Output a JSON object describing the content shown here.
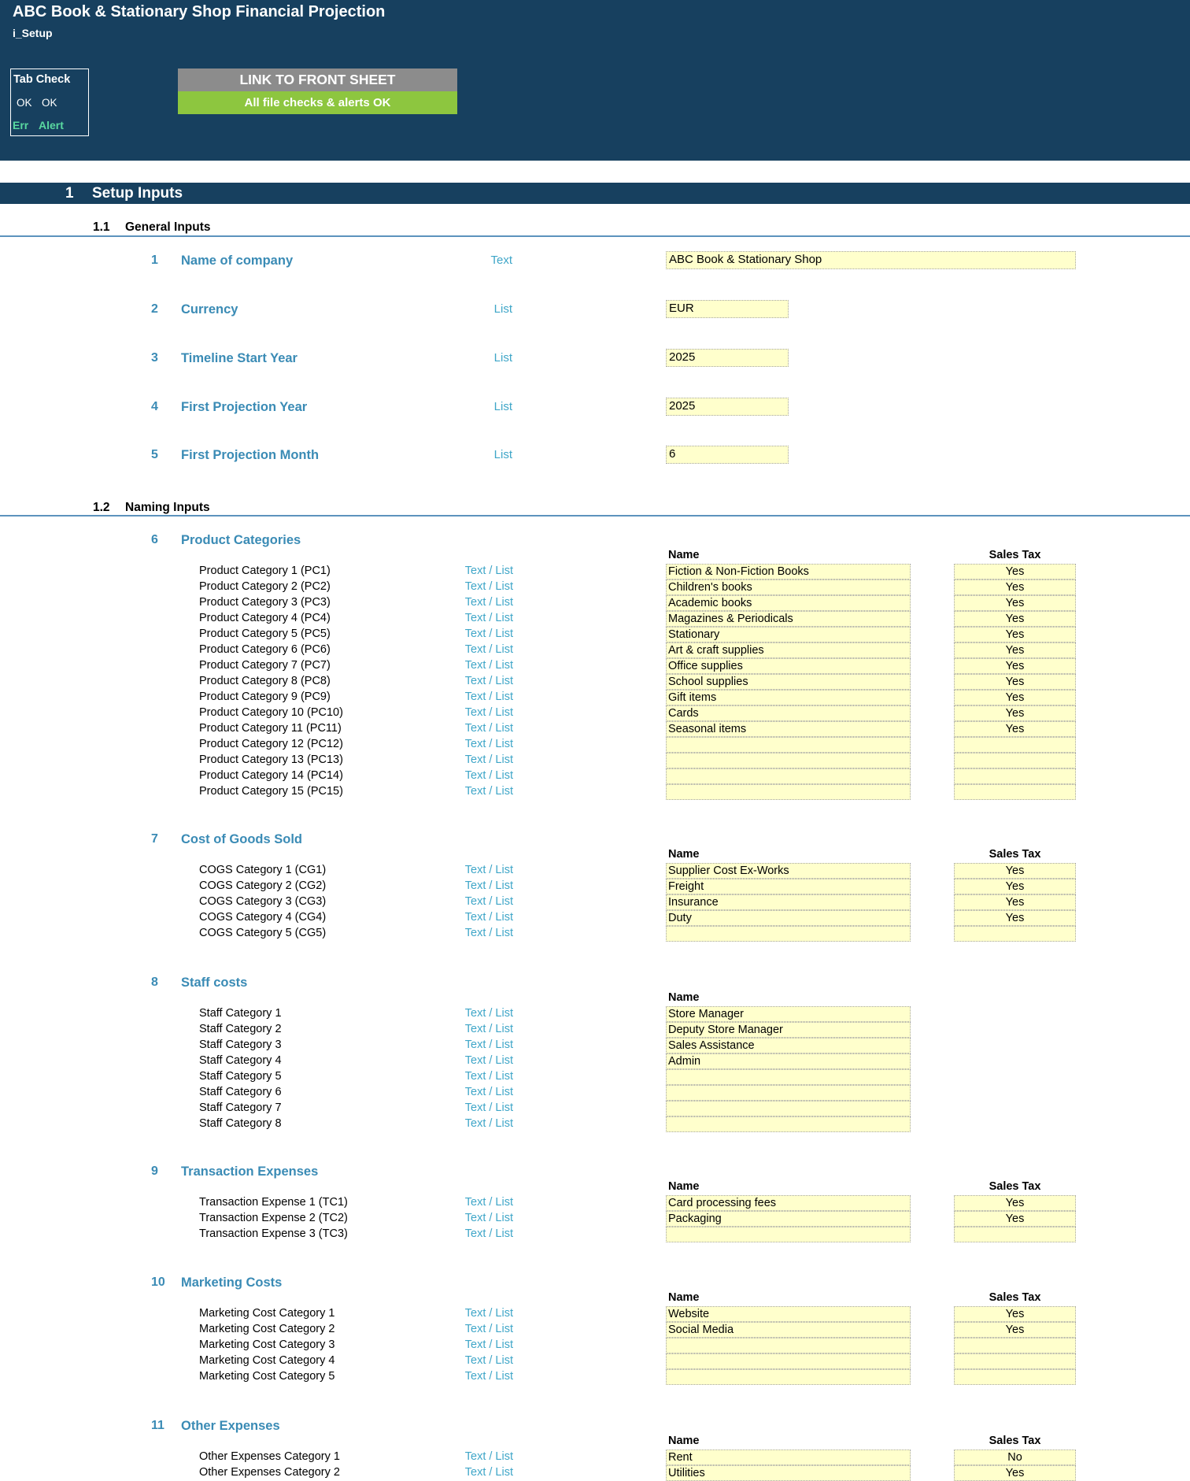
{
  "header": {
    "title": "ABC Book & Stationary Shop Financial Projection",
    "sheet": "i_Setup",
    "tab_check": {
      "title": "Tab Check",
      "ok1": "OK",
      "ok2": "OK",
      "err": "Err",
      "alert": "Alert"
    },
    "link_button": "LINK TO FRONT SHEET",
    "status": "All file checks & alerts OK"
  },
  "section": {
    "number": "1",
    "title": "Setup Inputs"
  },
  "general": {
    "number": "1.1",
    "title": "General Inputs",
    "items": [
      {
        "num": "1",
        "title": "Name of company",
        "type": "Text",
        "value": "ABC Book & Stationary Shop"
      },
      {
        "num": "2",
        "title": "Currency",
        "type": "List",
        "value": "EUR"
      },
      {
        "num": "3",
        "title": "Timeline Start Year",
        "type": "List",
        "value": "2025"
      },
      {
        "num": "4",
        "title": "First Projection Year",
        "type": "List",
        "value": "2025"
      },
      {
        "num": "5",
        "title": "First Projection Month",
        "type": "List",
        "value": "6"
      }
    ]
  },
  "naming": {
    "number": "1.2",
    "title": "Naming Inputs",
    "col_name": "Name",
    "col_tax": "Sales Tax",
    "row_type": "Text / List",
    "groups": [
      {
        "num": "6",
        "title": "Product Categories",
        "has_tax": true,
        "rows": [
          {
            "label": "Product Category 1 (PC1)",
            "name": "Fiction & Non-Fiction Books",
            "tax": "Yes"
          },
          {
            "label": "Product Category 2 (PC2)",
            "name": "Children's books",
            "tax": "Yes"
          },
          {
            "label": "Product Category 3 (PC3)",
            "name": "Academic books",
            "tax": "Yes"
          },
          {
            "label": "Product Category 4 (PC4)",
            "name": "Magazines & Periodicals",
            "tax": "Yes"
          },
          {
            "label": "Product Category 5 (PC5)",
            "name": "Stationary",
            "tax": "Yes"
          },
          {
            "label": "Product Category 6 (PC6)",
            "name": "Art & craft supplies",
            "tax": "Yes"
          },
          {
            "label": "Product Category 7 (PC7)",
            "name": "Office supplies",
            "tax": "Yes"
          },
          {
            "label": "Product Category 8 (PC8)",
            "name": "School supplies",
            "tax": "Yes"
          },
          {
            "label": "Product Category 9 (PC9)",
            "name": "Gift items",
            "tax": "Yes"
          },
          {
            "label": "Product Category 10 (PC10)",
            "name": "Cards",
            "tax": "Yes"
          },
          {
            "label": "Product Category 11 (PC11)",
            "name": "Seasonal items",
            "tax": "Yes"
          },
          {
            "label": "Product Category 12 (PC12)",
            "name": "",
            "tax": ""
          },
          {
            "label": "Product Category 13 (PC13)",
            "name": "",
            "tax": ""
          },
          {
            "label": "Product Category 14 (PC14)",
            "name": "",
            "tax": ""
          },
          {
            "label": "Product Category 15 (PC15)",
            "name": "",
            "tax": ""
          }
        ]
      },
      {
        "num": "7",
        "title": "Cost of Goods Sold",
        "has_tax": true,
        "rows": [
          {
            "label": "COGS Category 1 (CG1)",
            "name": "Supplier Cost Ex-Works",
            "tax": "Yes"
          },
          {
            "label": "COGS Category 2 (CG2)",
            "name": "Freight",
            "tax": "Yes"
          },
          {
            "label": "COGS Category 3 (CG3)",
            "name": "Insurance",
            "tax": "Yes"
          },
          {
            "label": "COGS Category 4 (CG4)",
            "name": "Duty",
            "tax": "Yes"
          },
          {
            "label": "COGS Category 5 (CG5)",
            "name": "",
            "tax": ""
          }
        ]
      },
      {
        "num": "8",
        "title": "Staff costs",
        "has_tax": false,
        "rows": [
          {
            "label": "Staff Category 1",
            "name": "Store Manager"
          },
          {
            "label": "Staff Category 2",
            "name": "Deputy Store Manager"
          },
          {
            "label": "Staff Category 3",
            "name": "Sales Assistance"
          },
          {
            "label": "Staff Category 4",
            "name": "Admin"
          },
          {
            "label": "Staff Category 5",
            "name": ""
          },
          {
            "label": "Staff Category 6",
            "name": ""
          },
          {
            "label": "Staff Category 7",
            "name": ""
          },
          {
            "label": "Staff Category 8",
            "name": ""
          }
        ]
      },
      {
        "num": "9",
        "title": "Transaction Expenses",
        "has_tax": true,
        "rows": [
          {
            "label": "Transaction Expense 1 (TC1)",
            "name": "Card processing fees",
            "tax": "Yes"
          },
          {
            "label": "Transaction Expense 2 (TC2)",
            "name": "Packaging",
            "tax": "Yes"
          },
          {
            "label": "Transaction Expense 3 (TC3)",
            "name": "",
            "tax": ""
          }
        ]
      },
      {
        "num": "10",
        "title": "Marketing Costs",
        "has_tax": true,
        "rows": [
          {
            "label": "Marketing Cost Category 1",
            "name": "Website",
            "tax": "Yes"
          },
          {
            "label": "Marketing Cost Category 2",
            "name": "Social Media",
            "tax": "Yes"
          },
          {
            "label": "Marketing Cost Category 3",
            "name": "",
            "tax": ""
          },
          {
            "label": "Marketing Cost Category 4",
            "name": "",
            "tax": ""
          },
          {
            "label": "Marketing Cost Category 5",
            "name": "",
            "tax": ""
          }
        ]
      },
      {
        "num": "11",
        "title": "Other Expenses",
        "has_tax": true,
        "rows": [
          {
            "label": "Other Expenses Category 1",
            "name": "Rent",
            "tax": "No"
          },
          {
            "label": "Other Expenses Category 2",
            "name": "Utilities",
            "tax": "Yes"
          }
        ]
      }
    ]
  }
}
